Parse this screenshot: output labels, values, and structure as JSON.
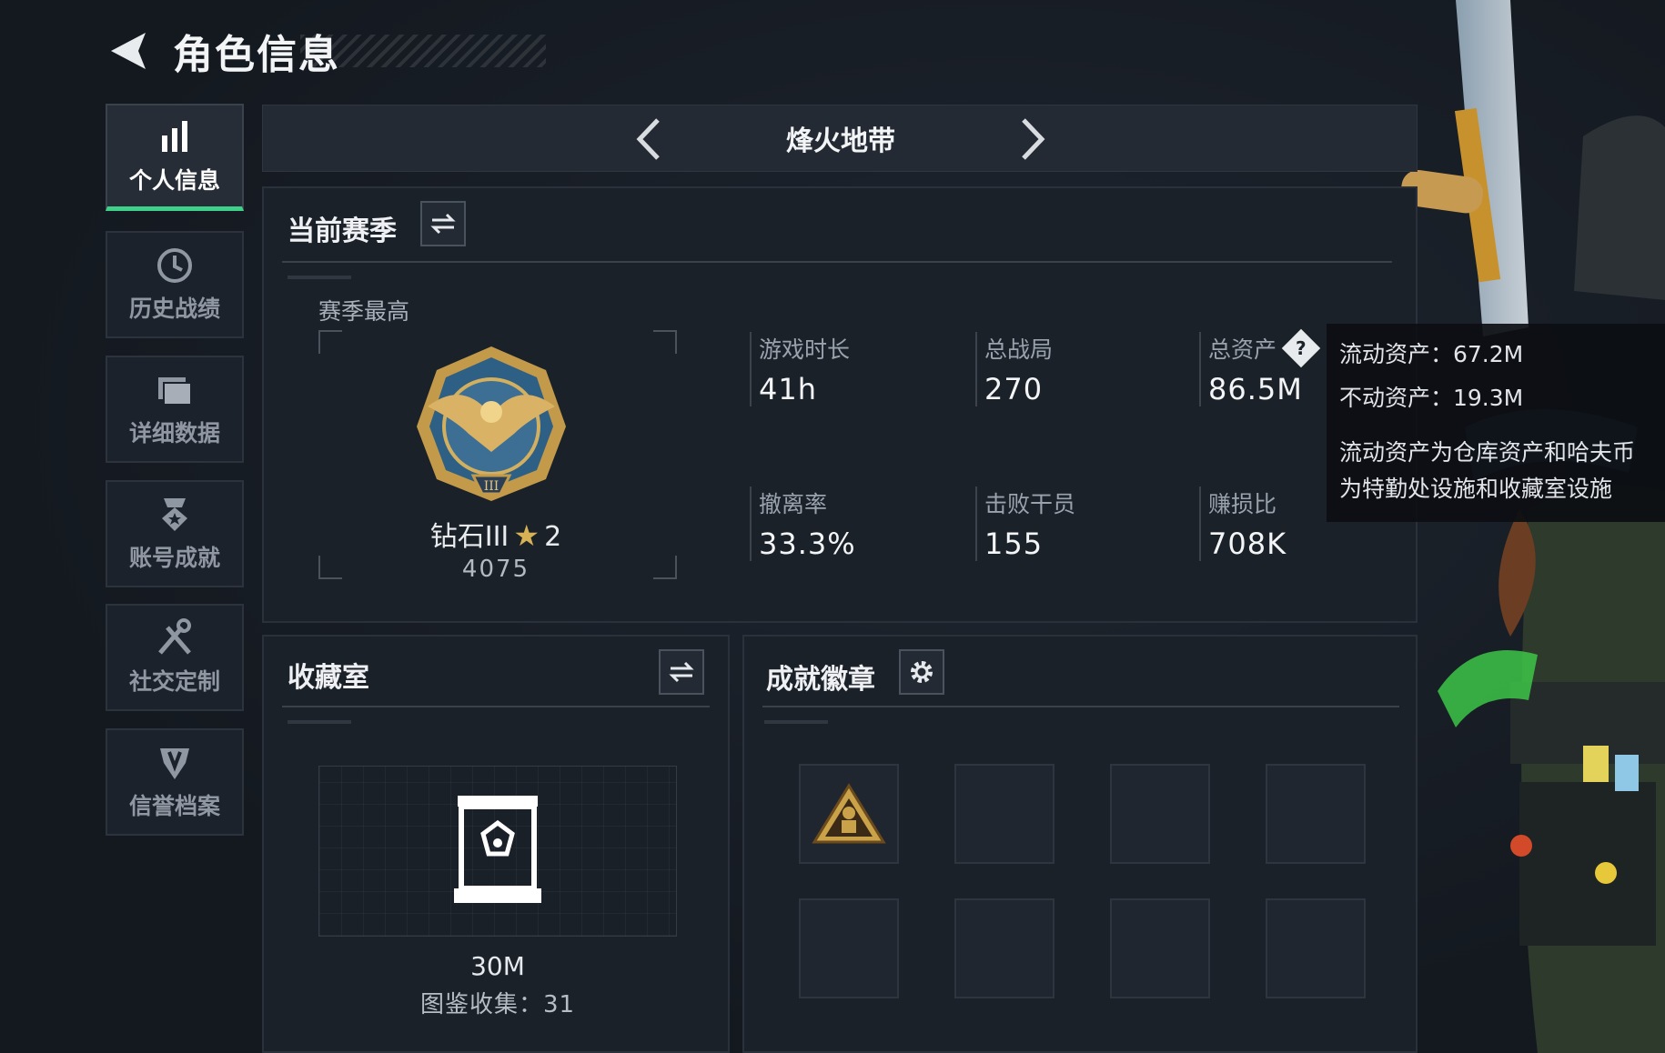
{
  "header": {
    "title": "角色信息"
  },
  "sidebar": {
    "items": [
      {
        "label": "个人信息",
        "icon": "bar-chart-icon",
        "active": true
      },
      {
        "label": "历史战绩",
        "icon": "clock-icon",
        "active": false
      },
      {
        "label": "详细数据",
        "icon": "folder-icon",
        "active": false
      },
      {
        "label": "账号成就",
        "icon": "medal-icon",
        "active": false
      },
      {
        "label": "社交定制",
        "icon": "tools-icon",
        "active": false
      },
      {
        "label": "信誉档案",
        "icon": "shield-icon",
        "active": false
      }
    ]
  },
  "mode": {
    "title": "烽火地带"
  },
  "season": {
    "title": "当前赛季",
    "best_label": "赛季最高",
    "rank_name": "钻石III",
    "rank_stars": "2",
    "rank_score": "4075",
    "stats": [
      {
        "label": "游戏时长",
        "value": "41h"
      },
      {
        "label": "总战局",
        "value": "270"
      },
      {
        "label": "总资产",
        "value": "86.5M"
      },
      {
        "label": "撤离率",
        "value": "33.3%"
      },
      {
        "label": "击败干员",
        "value": "155"
      },
      {
        "label": "赚损比",
        "value": "708K"
      }
    ]
  },
  "tooltip": {
    "line1": "流动资产：67.2M",
    "line2": "不动资产：19.3M",
    "line3": "流动资产为仓库资产和哈夫币",
    "line4": "为特勤处设施和收藏室设施"
  },
  "collection": {
    "title": "收藏室",
    "value": "30M",
    "collect_text": "图鉴收集：31"
  },
  "badges": {
    "title": "成就徽章",
    "slots_filled": 1,
    "slots_total": 8
  },
  "colors": {
    "accent_green": "#3fd08a",
    "gold": "#c9a24a",
    "background": "#161b22"
  }
}
